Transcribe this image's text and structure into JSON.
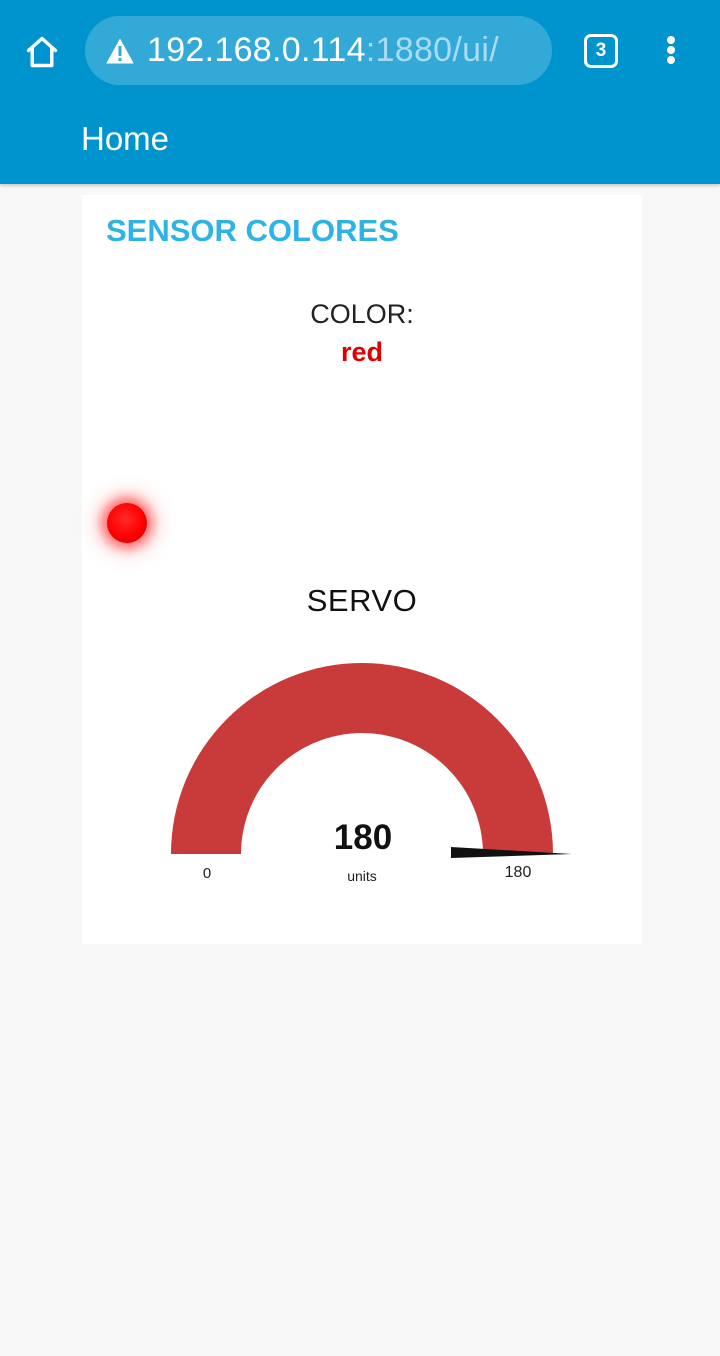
{
  "browser": {
    "url_host": "192.168.0.114",
    "url_rest": ":1880/ui/",
    "tab_count": "3",
    "icons": [
      "home-icon",
      "warning-icon",
      "tabs-icon",
      "more-vert-icon"
    ]
  },
  "header": {
    "title": "Home"
  },
  "group": {
    "title": "SENSOR COLORES",
    "color_label": "COLOR:",
    "color_value": "red",
    "led_color": "#ff0000"
  },
  "gauge": {
    "title": "SERVO",
    "value": "180",
    "units": "units",
    "min": "0",
    "max": "180",
    "fill_fraction": 1,
    "fill_color": "#c93a3a"
  },
  "colors": {
    "primary": "#0094ce",
    "group_title": "#2eb3e4",
    "value_red": "#e00000"
  }
}
